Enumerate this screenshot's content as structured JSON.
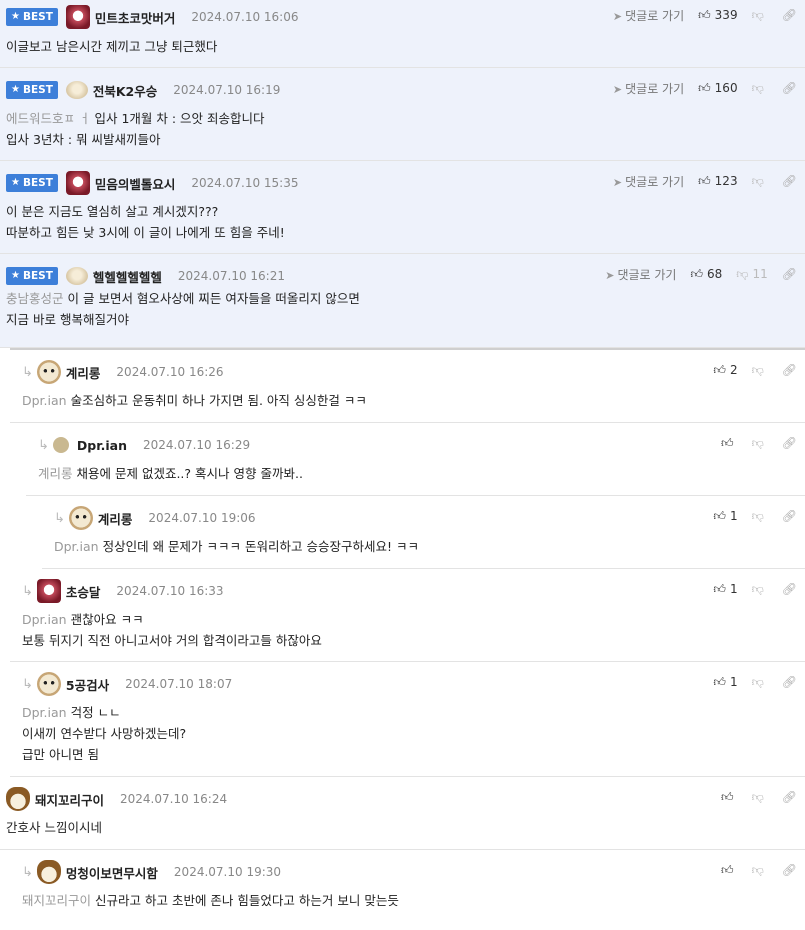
{
  "labels": {
    "best": "BEST",
    "reply_link": "댓글로 가기"
  },
  "comments": [
    {
      "nick": "민트초코맛버거",
      "date": "2024.07.10 16:06",
      "likes": "339",
      "dislikes": "",
      "lines": [
        "이글보고 남은시간 제끼고 그냥 퇴근했다"
      ],
      "mention": ""
    },
    {
      "nick": "전북K2우승",
      "date": "2024.07.10 16:19",
      "likes": "160",
      "dislikes": "",
      "mention": "에드워드호ㅍ ㅓ",
      "lines": [
        "입사 1개월 차 : 으앗 죄송합니다",
        "입사 3년차 : 뭐 씨발새끼들아"
      ]
    },
    {
      "nick": "믿음의벨톨요시",
      "date": "2024.07.10 15:35",
      "likes": "123",
      "dislikes": "",
      "mention": "",
      "lines": [
        "이 분은 지금도 열심히 살고 계시겠지???",
        "따분하고 힘든 낮 3시에 이 글이 나에게 또 힘을 주네!"
      ]
    },
    {
      "nick": "헬헬헬헬헬헬",
      "date": "2024.07.10 16:21",
      "likes": "68",
      "dislikes": "11",
      "mention": "충남홍성군",
      "lines": [
        "이 글 보면서 혐오사상에 찌든 여자들을 떠올리지 않으면",
        "지금 바로 행복해질거야"
      ]
    },
    {
      "nick": "계리롱",
      "date": "2024.07.10 16:26",
      "likes": "2",
      "mention": "Dpr.ian",
      "lines": [
        "술조심하고 운동취미 하나 가지면 됨. 아직 싱싱한걸 ㅋㅋ"
      ]
    },
    {
      "nick": "Dpr.ian",
      "date": "2024.07.10 16:29",
      "likes": "",
      "mention": "계리롱",
      "lines": [
        "채용에 문제 없겠죠..? 혹시나 영향 줄까봐.."
      ]
    },
    {
      "nick": "계리롱",
      "date": "2024.07.10 19:06",
      "likes": "1",
      "mention": "Dpr.ian",
      "lines": [
        "정상인데 왜 문제가 ㅋㅋㅋ 돈워리하고 승승장구하세요! ㅋㅋ"
      ]
    },
    {
      "nick": "초승달",
      "date": "2024.07.10 16:33",
      "likes": "1",
      "mention": "Dpr.ian",
      "lines": [
        "괜찮아요 ㅋㅋ",
        "보통 뒤지기 직전 아니고서야 거의 합격이라고들 하잖아요"
      ]
    },
    {
      "nick": "5공검사",
      "date": "2024.07.10 18:07",
      "likes": "1",
      "mention": "Dpr.ian",
      "lines": [
        "걱정 ㄴㄴ",
        "이새끼 연수받다 사망하겠는데?",
        "급만 아니면 됨"
      ]
    },
    {
      "nick": "돼지꼬리구이",
      "date": "2024.07.10 16:24",
      "likes": "",
      "mention": "",
      "lines": [
        "간호사 느낌이시네"
      ]
    },
    {
      "nick": "멍청이보면무시함",
      "date": "2024.07.10 19:30",
      "likes": "",
      "mention": "돼지꼬리구이",
      "lines": [
        "신규라고 하고 초반에 존나 힘들었다고 하는거 보니 맞는듯"
      ]
    }
  ]
}
